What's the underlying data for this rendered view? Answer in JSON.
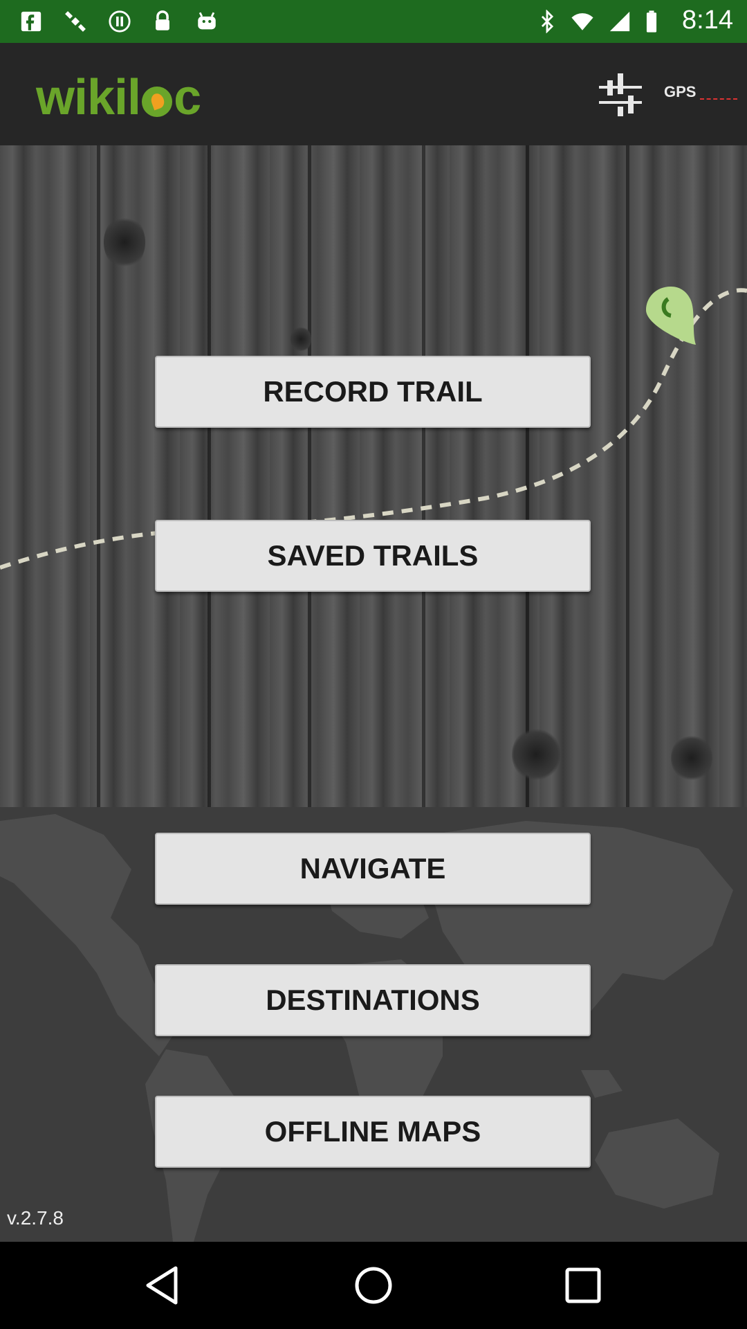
{
  "status_bar": {
    "time": "8:14",
    "icons": [
      "facebook-icon",
      "satellite-icon",
      "pause-circle-icon",
      "lock-icon",
      "android-icon",
      "bluetooth-icon",
      "wifi-icon",
      "signal-icon",
      "battery-icon"
    ]
  },
  "header": {
    "logo_text_before": "wikil",
    "logo_text_after": "c",
    "gps_label": "GPS"
  },
  "menu": {
    "record_trail": "RECORD TRAIL",
    "saved_trails": "SAVED TRAILS",
    "navigate": "NAVIGATE",
    "destinations": "DESTINATIONS",
    "offline_maps": "OFFLINE MAPS"
  },
  "footer": {
    "version": "v.2.7.8"
  },
  "colors": {
    "status_bar": "#1e6b1f",
    "brand_green": "#6aa52a",
    "brand_orange": "#f0a020",
    "button_bg": "#e4e4e4"
  }
}
